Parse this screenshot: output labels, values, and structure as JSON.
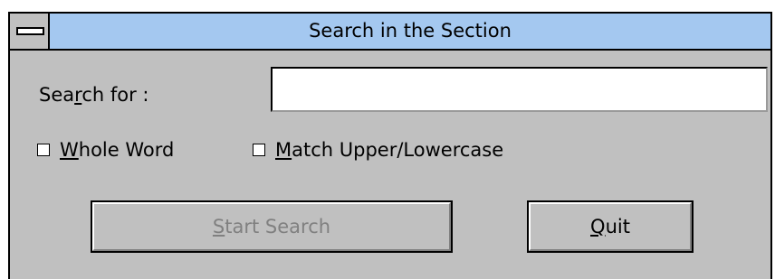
{
  "window": {
    "title": "Search in the Section"
  },
  "form": {
    "search_label_before": "Sea",
    "search_label_mnemonic": "r",
    "search_label_after": "ch for :",
    "search_value": "",
    "whole_word_mnemonic": "W",
    "whole_word_rest": "hole Word",
    "match_case_mnemonic": "M",
    "match_case_rest": "atch Upper/Lowercase"
  },
  "buttons": {
    "start_mnemonic": "S",
    "start_rest": "tart Search",
    "quit_mnemonic": "Q",
    "quit_rest": "uit"
  },
  "colors": {
    "titlebar": "#a4c8f0",
    "dialog": "#c0c0c0",
    "disabled_text": "#808080"
  },
  "icons": {
    "system_menu": "system-menu-icon"
  }
}
